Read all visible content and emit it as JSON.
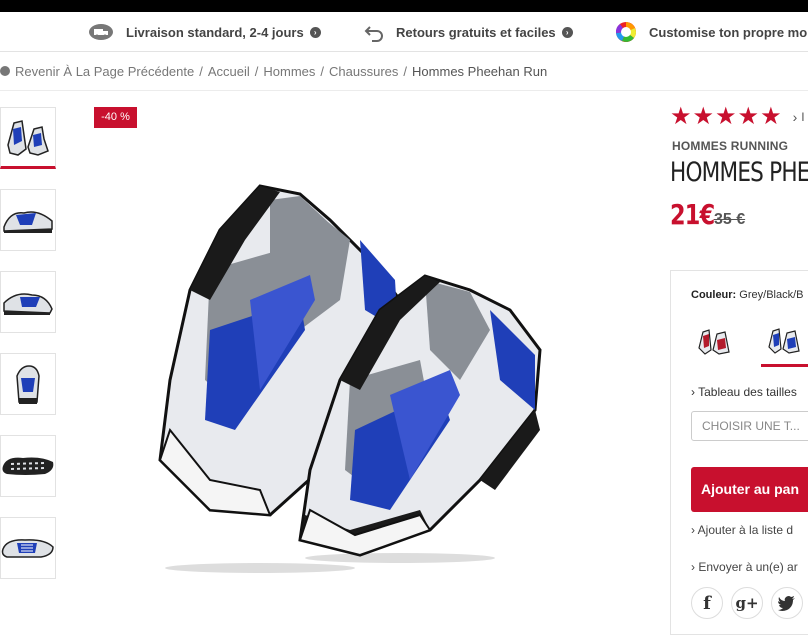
{
  "perks": [
    {
      "label": "Livraison standard, 2-4 jours",
      "icon": "truck-icon"
    },
    {
      "label": "Retours gratuits et faciles",
      "icon": "return-arrow-icon"
    },
    {
      "label": "Customise ton propre mo",
      "icon": "color-wheel-icon"
    }
  ],
  "breadcrumb": {
    "back": "Revenir À La Page Précédente",
    "items": [
      "Accueil",
      "Hommes",
      "Chaussures"
    ],
    "current": "Hommes Pheehan Run"
  },
  "discount_badge": "-40 %",
  "product": {
    "rating_stars": 5,
    "reviews_label": "I",
    "category": "HOMMES RUNNING",
    "name": "HOMMES PHEE",
    "price": "21€",
    "old_price": "35 €"
  },
  "options": {
    "colour_label": "Couleur:",
    "colour_value": "Grey/Black/B",
    "size_chart": "Tableau des tailles",
    "size_placeholder": "CHOISIR UNE T...",
    "add_to_cart": "Ajouter au pan",
    "wishlist": "Ajouter à la liste d",
    "send_friend": "Envoyer à un(e) ar"
  },
  "social": [
    "f",
    "g+",
    "twitter"
  ],
  "colors": {
    "accent": "#c8102e",
    "shoe_blue": "#1f3fb8",
    "shoe_black": "#1a1a1a",
    "shoe_grey": "#8a8f96"
  }
}
